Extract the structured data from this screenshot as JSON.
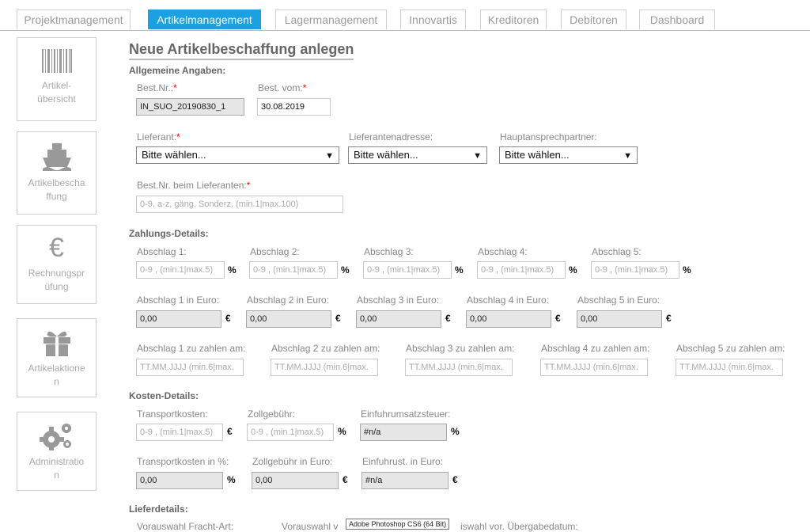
{
  "tabs": [
    "Projektmanagement",
    "Artikelmanagement",
    "Lagermanagement",
    "Innovartis",
    "Kreditoren",
    "Debitoren",
    "Dashboard"
  ],
  "active_tab": "Artikelmanagement",
  "sidebar": [
    {
      "label": "Artikel-übersicht",
      "icon": "barcode-icon"
    },
    {
      "label": "Artikelbeschaffung",
      "icon": "ship-icon"
    },
    {
      "label": "Rechnungsprüfung",
      "icon": "euro-icon"
    },
    {
      "label": "Artikelaktionen",
      "icon": "gift-icon"
    },
    {
      "label": "Administration",
      "icon": "gears-icon"
    }
  ],
  "page_title": "Neue Artikelbeschaffung anlegen",
  "general": {
    "heading": "Allgemeine Angaben:",
    "best_nr_label": "Best.Nr.:",
    "best_nr_value": "IN_SUO_20190830_1",
    "best_vom_label": "Best. vom:",
    "best_vom_value": "30.08.2019",
    "lieferant_label": "Lieferant:",
    "lieferantenadresse_label": "Lieferantenadresse:",
    "hauptansprechpartner_label": "Hauptansprechpartner:",
    "select_placeholder": "Bitte wählen...",
    "best_nr_lieferant_label": "Best.Nr. beim Lieferanten:",
    "best_nr_lieferant_placeholder": "0-9, a-z, gäng. Sonderz. (min.1|max.100)"
  },
  "payment": {
    "heading": "Zahlungs-Details:",
    "abschlag_labels": [
      "Abschlag 1:",
      "Abschlag 2:",
      "Abschlag 3:",
      "Abschlag 4:",
      "Abschlag 5:"
    ],
    "abschlag_placeholder": "0-9 , (min.1|max.5)",
    "euro_labels": [
      "Abschlag 1 in Euro:",
      "Abschlag 2 in Euro:",
      "Abschlag 3 in Euro:",
      "Abschlag 4 in Euro:",
      "Abschlag 5 in Euro:"
    ],
    "euro_value": "0,00",
    "date_labels": [
      "Abschlag 1 zu zahlen am:",
      "Abschlag 2 zu zahlen am:",
      "Abschlag 3 zu zahlen am:",
      "Abschlag 4 zu zahlen am:",
      "Abschlag 5 zu zahlen am:"
    ],
    "date_placeholder": "TT.MM.JJJJ (min.6|max.",
    "percent": "%",
    "euro": "€"
  },
  "costs": {
    "heading": "Kosten-Details:",
    "transport_label": "Transportkosten:",
    "zoll_label": "Zollgebühr:",
    "eust_label": "Einfuhrumsatzsteuer:",
    "placeholder": "0-9 , (min.1|max.5)",
    "eust_value": "#n/a",
    "transport_pct_label": "Transportkosten in %:",
    "zoll_euro_label": "Zollgebühr in Euro:",
    "eust_euro_label": "Einfuhrust. in Euro:",
    "transport_pct_value": "0,00",
    "zoll_euro_value": "0,00",
    "eust_euro_value": "#n/a"
  },
  "delivery": {
    "heading": "Lieferdetails:",
    "label1": "Vorauswahl Fracht-Art:",
    "label2": "Vorauswahl v",
    "label3": "iswahl vor. Übergabedatum:"
  },
  "tooltip": "Adobe Photoshop CS6 (64 Bit)"
}
